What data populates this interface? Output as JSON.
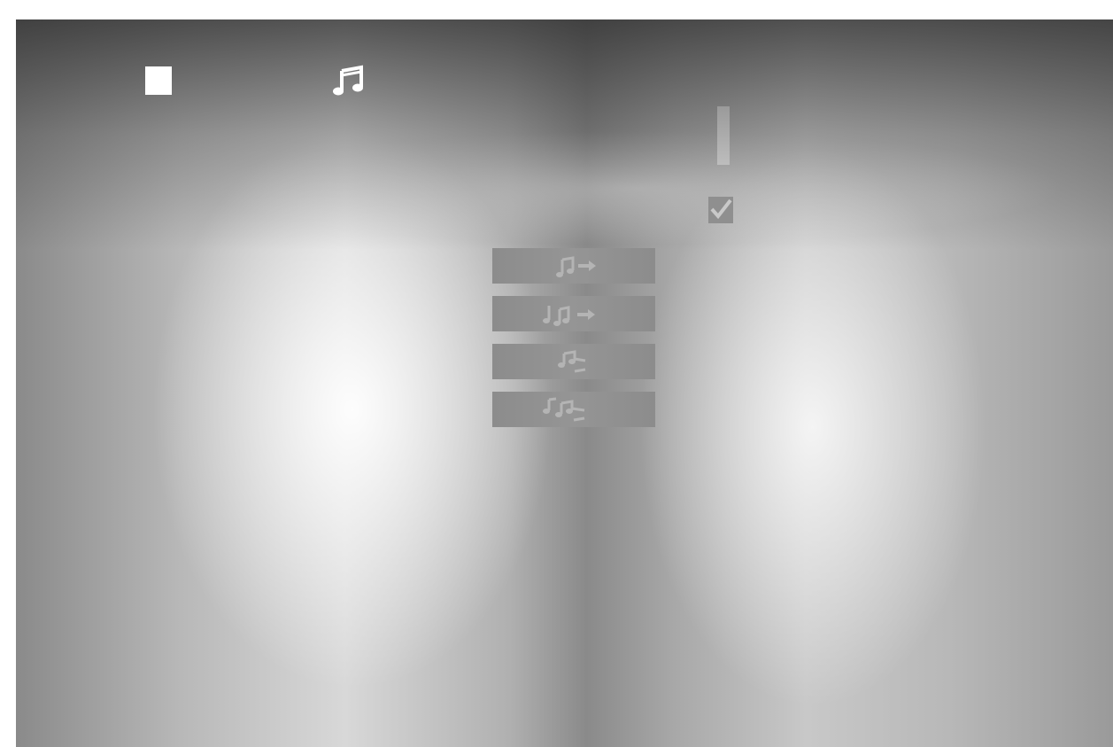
{
  "screen": {
    "background_colors": [
      "#ffffff",
      "#8a8a8a",
      "#d8d8d8",
      "#2a2a2a"
    ]
  },
  "status_bar": {
    "playback_icon": "stop-icon",
    "mode_icon": "music-note-icon"
  },
  "side_indicator": {
    "level_icon": "level-bar-icon",
    "checkbox_icon": "checkmark-icon",
    "checked": true
  },
  "menu": {
    "buttons": [
      {
        "icon": "single-note-arrow-icon"
      },
      {
        "icon": "double-note-arrow-icon"
      },
      {
        "icon": "single-note-return-icon"
      },
      {
        "icon": "double-note-return-icon"
      }
    ]
  }
}
